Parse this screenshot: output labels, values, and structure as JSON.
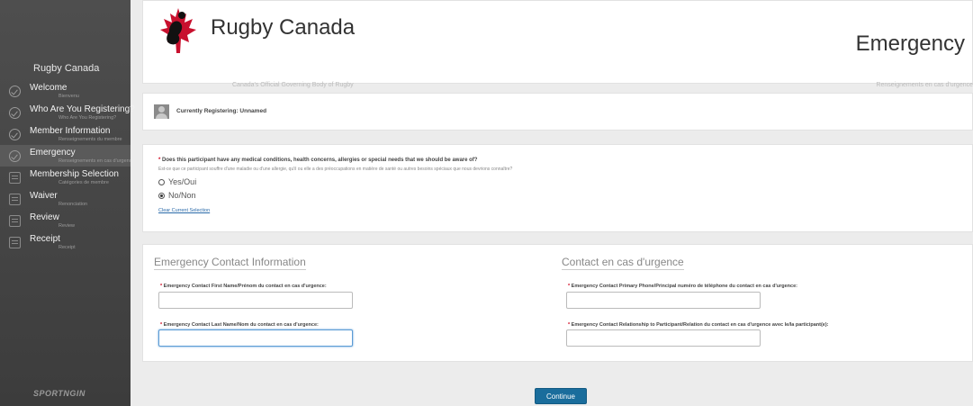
{
  "brand": {
    "name": "Rugby Canada",
    "tagline": "Canada's Official Governing Body of Rugby",
    "powered_by": "SPORTNGIN"
  },
  "sidebar": {
    "title": "Rugby Canada",
    "items": [
      {
        "label": "Welcome",
        "sub": "Bienvenu",
        "icon": "check-circle-icon"
      },
      {
        "label": "Who Are You Registering?",
        "sub": "Who Are You Registering?",
        "icon": "check-circle-icon"
      },
      {
        "label": "Member Information",
        "sub": "Renseignements du membre",
        "icon": "check-circle-icon"
      },
      {
        "label": "Emergency",
        "sub": "Renseignements en cas d'urgence",
        "icon": "check-circle-icon",
        "active": true
      },
      {
        "label": "Membership Selection",
        "sub": "Catégories de membre",
        "icon": "document-icon"
      },
      {
        "label": "Waiver",
        "sub": "Renonciation",
        "icon": "document-icon"
      },
      {
        "label": "Review",
        "sub": "Review",
        "icon": "document-icon"
      },
      {
        "label": "Receipt",
        "sub": "Receipt",
        "icon": "document-icon"
      }
    ]
  },
  "header": {
    "page_title": "Emergency",
    "page_subtitle": "Renseignements en cas d'urgence"
  },
  "registering": {
    "text": "Currently Registering: Unnamed"
  },
  "medical": {
    "required_mark": "*",
    "question": "Does this participant have any medical conditions, health concerns, allergies or special needs that we should be aware of?",
    "question_fr": "Est-ce que ce participant souffre d'une maladie ou d'une allergie, qu'il ou elle a des préoccupations en matière de santé ou autres besoins spéciaux que nous devrions connaître?",
    "options": [
      {
        "label": "Yes/Oui",
        "selected": false
      },
      {
        "label": "No/Non",
        "selected": true
      }
    ],
    "clear_label": "Clear Current Selection"
  },
  "contact": {
    "title_en": "Emergency Contact Information",
    "title_fr": "Contact en cas d'urgence",
    "first_name_label": "Emergency Contact First Name/Prénom du contact en cas d'urgence:",
    "last_name_label": "Emergency Contact Last Name/Nom du contact en cas d'urgence:",
    "phone_label": "Emergency Contact Primary Phone/Principal numéro de téléphone du contact en cas d'urgence:",
    "relationship_label": "Emergency Contact Relationship to Participant/Relation du contact en cas d'urgence avec le/la participant(e):",
    "first_name_value": "",
    "last_name_value": "",
    "phone_value": "",
    "relationship_value": ""
  },
  "actions": {
    "continue_label": "Continue"
  },
  "colors": {
    "sidebar_bg": "#4a4a4a",
    "accent": "#1a6d9c",
    "required": "#d0021b"
  }
}
